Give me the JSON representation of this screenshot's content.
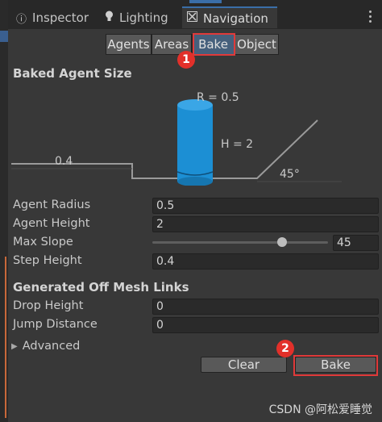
{
  "window_tabs": [
    {
      "label": "Inspector",
      "icon": "info-icon",
      "active": false
    },
    {
      "label": "Lighting",
      "icon": "lightbulb-icon",
      "active": false
    },
    {
      "label": "Navigation",
      "icon": "navigation-icon",
      "active": true
    }
  ],
  "nav_tabs": [
    "Agents",
    "Areas",
    "Bake",
    "Object"
  ],
  "selected_nav_tab": "Bake",
  "annotations": {
    "one": "1",
    "two": "2"
  },
  "baked_agent_size": {
    "title": "Baked Agent Size",
    "radius_text": "R = 0.5",
    "height_text": "H = 2",
    "step_text": "0.4",
    "slope_text": "45°"
  },
  "fields": {
    "agent_radius": {
      "label": "Agent Radius",
      "value": "0.5"
    },
    "agent_height": {
      "label": "Agent Height",
      "value": "2"
    },
    "max_slope": {
      "label": "Max Slope",
      "value": "45",
      "slider_fraction": 0.75
    },
    "step_height": {
      "label": "Step Height",
      "value": "0.4"
    }
  },
  "off_mesh": {
    "title": "Generated Off Mesh Links",
    "drop_height": {
      "label": "Drop Height",
      "value": "0"
    },
    "jump_distance": {
      "label": "Jump Distance",
      "value": "0"
    }
  },
  "advanced_label": "Advanced",
  "buttons": {
    "clear": "Clear",
    "bake": "Bake"
  },
  "watermark": "CSDN @阿松爱睡觉",
  "colors": {
    "accent": "#3a6ea8",
    "cylinder": "#1c8fd4",
    "annotation_red": "#e03a3a"
  }
}
